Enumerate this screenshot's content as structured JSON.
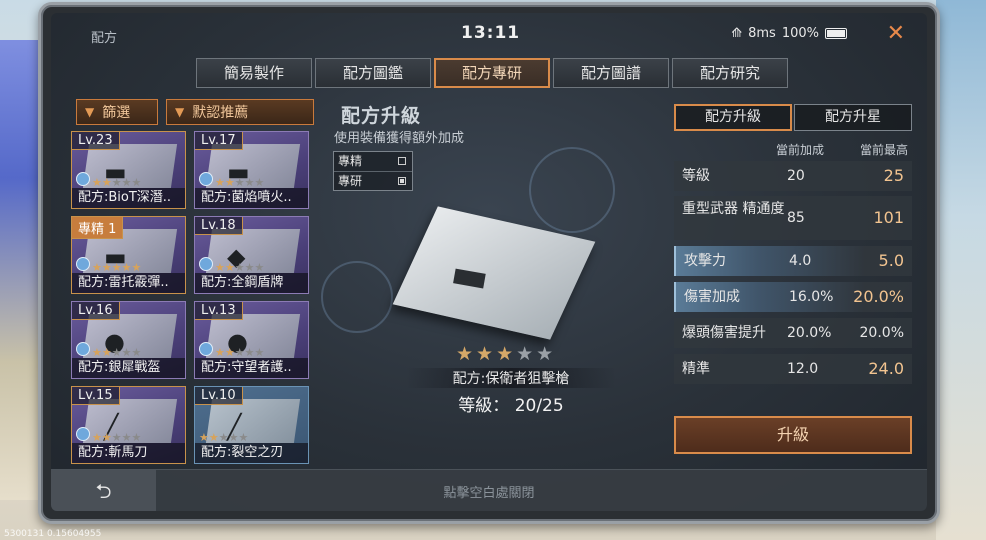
{
  "window": {
    "title": "配方",
    "clock": "13:11",
    "wifi": "8ms",
    "battery": "100%",
    "close": "✕"
  },
  "tabs": [
    {
      "label": "簡易製作",
      "active": false
    },
    {
      "label": "配方圖鑑",
      "active": false
    },
    {
      "label": "配方專研",
      "active": true
    },
    {
      "label": "配方圖譜",
      "active": false
    },
    {
      "label": "配方研究",
      "active": false
    }
  ],
  "filters": {
    "filter": "篩選",
    "default": "默認推薦"
  },
  "cards": [
    {
      "level": "Lv.23",
      "name": "配方:BioT深潛..",
      "stars": 2,
      "icon": "rifle-icon"
    },
    {
      "level": "Lv.17",
      "name": "配方:菌焰噴火..",
      "stars": 2,
      "icon": "flamethrower-icon"
    },
    {
      "level": "專精 1",
      "name": "配方:雷托霰彈..",
      "stars": 5,
      "icon": "shotgun-icon"
    },
    {
      "level": "Lv.18",
      "name": "配方:全鋼盾牌",
      "stars": 2,
      "icon": "shield-icon"
    },
    {
      "level": "Lv.16",
      "name": "配方:銀犀戰盔",
      "stars": 2,
      "icon": "helmet-icon"
    },
    {
      "level": "Lv.13",
      "name": "配方:守望者護..",
      "stars": 2,
      "icon": "armor-icon"
    },
    {
      "level": "Lv.15",
      "name": "配方:斬馬刀",
      "stars": 2,
      "icon": "sword-icon"
    },
    {
      "level": "Lv.10",
      "name": "配方:裂空之刃",
      "stars": 2,
      "icon": "blade-icon"
    }
  ],
  "middle": {
    "title": "配方升級",
    "subtitle": "使用裝備獲得額外加成",
    "legend": [
      "專精",
      "專研"
    ],
    "item_name": "配方:保衛者狙擊槍",
    "item_level": "等級： 20/25",
    "stars_filled": 3,
    "stars_total": 5
  },
  "right": {
    "tabs": [
      {
        "label": "配方升級",
        "active": true
      },
      {
        "label": "配方升星",
        "active": false
      }
    ],
    "col_current": "當前加成",
    "col_max": "當前最高",
    "stats": [
      {
        "label": "等級",
        "current": "20",
        "max": "25",
        "highlight": false
      },
      {
        "label": "重型武器 精通度",
        "current": "85",
        "max": "101",
        "highlight": false
      },
      {
        "label": "攻擊力",
        "current": "4.0",
        "max": "5.0",
        "highlight": true
      },
      {
        "label": "傷害加成",
        "current": "16.0%",
        "max": "20.0%",
        "highlight": true
      },
      {
        "label": "爆頭傷害提升",
        "current": "20.0%",
        "max": "20.0%",
        "highlight": false
      },
      {
        "label": "精準",
        "current": "12.0",
        "max": "24.0",
        "highlight": false
      }
    ],
    "upgrade": "升級"
  },
  "bottom": {
    "back": "⮌",
    "hint": "點擊空白處關閉"
  },
  "debug": "5300131 0.15604955"
}
